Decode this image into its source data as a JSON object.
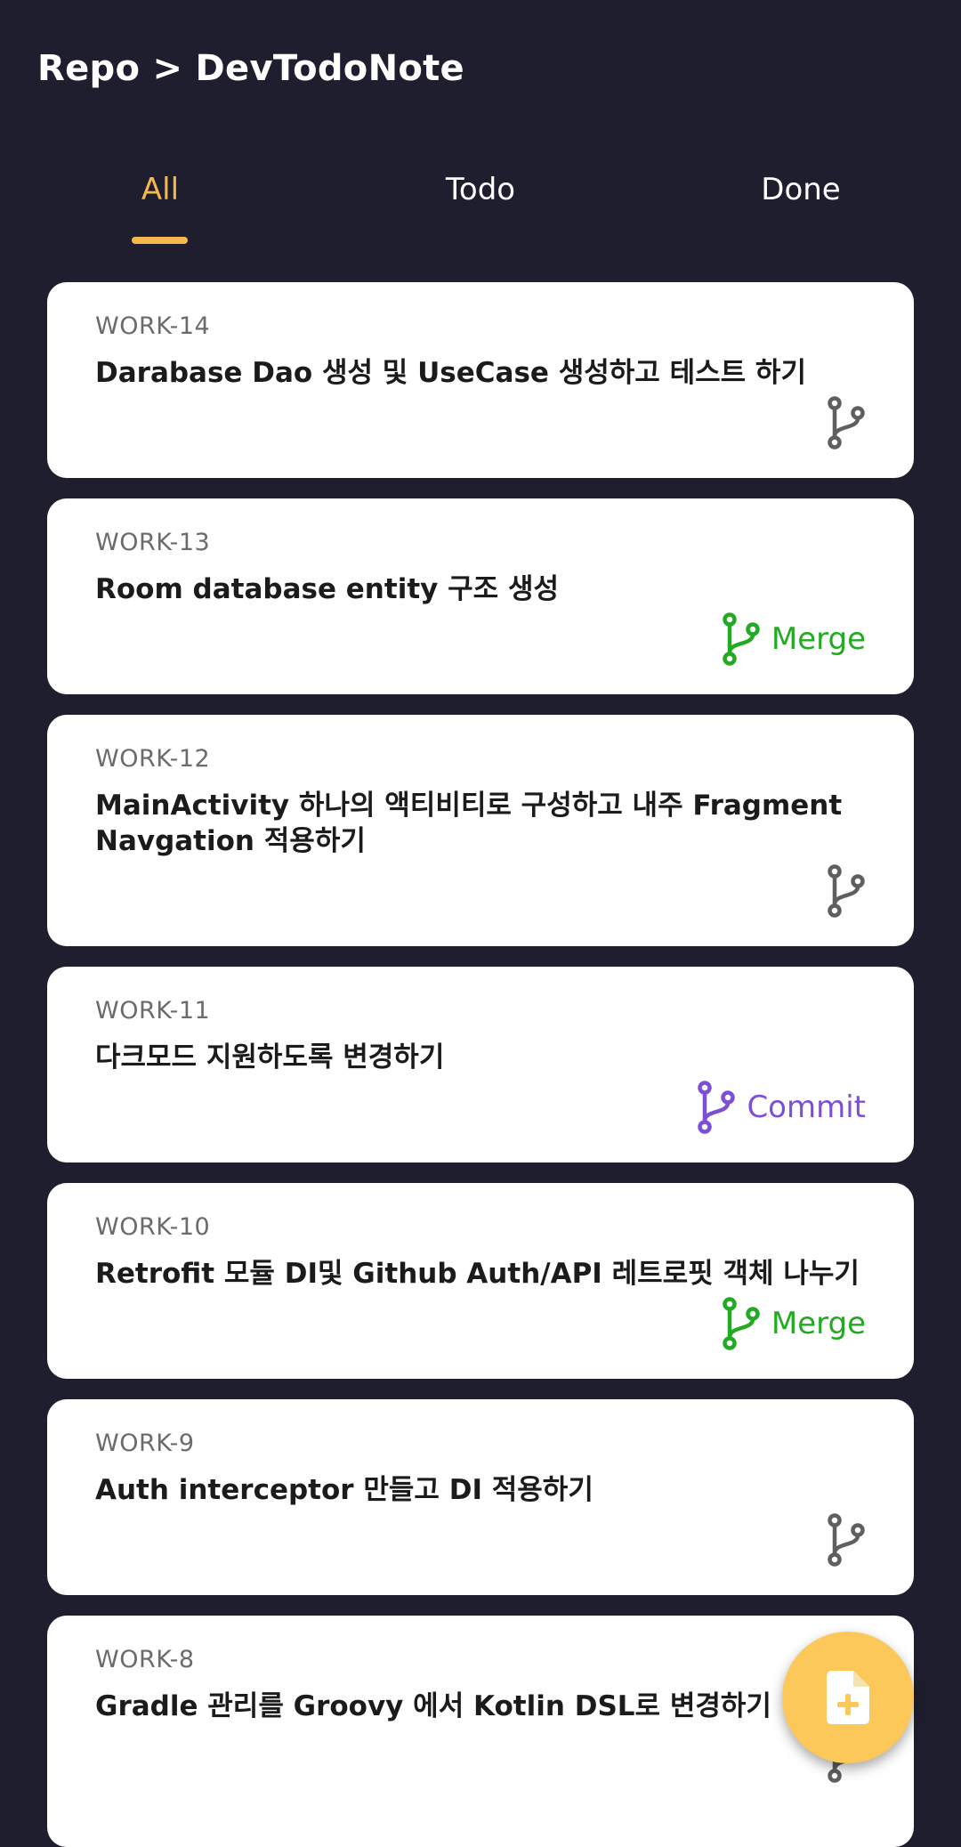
{
  "header": {
    "title": "Repo > DevTodoNote"
  },
  "tabs": [
    {
      "label": "All",
      "active": true
    },
    {
      "label": "Todo",
      "active": false
    },
    {
      "label": "Done",
      "active": false
    }
  ],
  "colors": {
    "background": "#1e1e2e",
    "accent": "#f6b84e",
    "card": "#ffffff",
    "status_none": "#5f5f5f",
    "status_merge": "#22aa22",
    "status_commit": "#7c4fd6",
    "fab": "#fcc85a"
  },
  "cards": [
    {
      "id": "WORK-14",
      "title": "Darabase Dao 생성 및 UseCase 생성하고 테스트 하기",
      "status": "",
      "icon": "git-branch-icon"
    },
    {
      "id": "WORK-13",
      "title": "Room database entity 구조 생성",
      "status": "Merge",
      "icon": "git-branch-icon"
    },
    {
      "id": "WORK-12",
      "title": "MainActivity 하나의 액티비티로 구성하고 내주 Fragment Navgation 적용하기",
      "status": "",
      "icon": "git-branch-icon"
    },
    {
      "id": "WORK-11",
      "title": "다크모드 지원하도록 변경하기",
      "status": "Commit",
      "icon": "git-branch-icon"
    },
    {
      "id": "WORK-10",
      "title": "Retrofit 모듈 DI및 Github Auth/API 레트로핏 객체 나누기",
      "status": "Merge",
      "icon": "git-branch-icon"
    },
    {
      "id": "WORK-9",
      "title": "Auth interceptor 만들고 DI 적용하기",
      "status": "",
      "icon": "git-branch-icon"
    },
    {
      "id": "WORK-8",
      "title": "Gradle 관리를 Groovy 에서 Kotlin DSL로 변경하기",
      "status": "",
      "icon": "git-branch-icon"
    }
  ],
  "fab": {
    "icon": "add-document-icon"
  }
}
